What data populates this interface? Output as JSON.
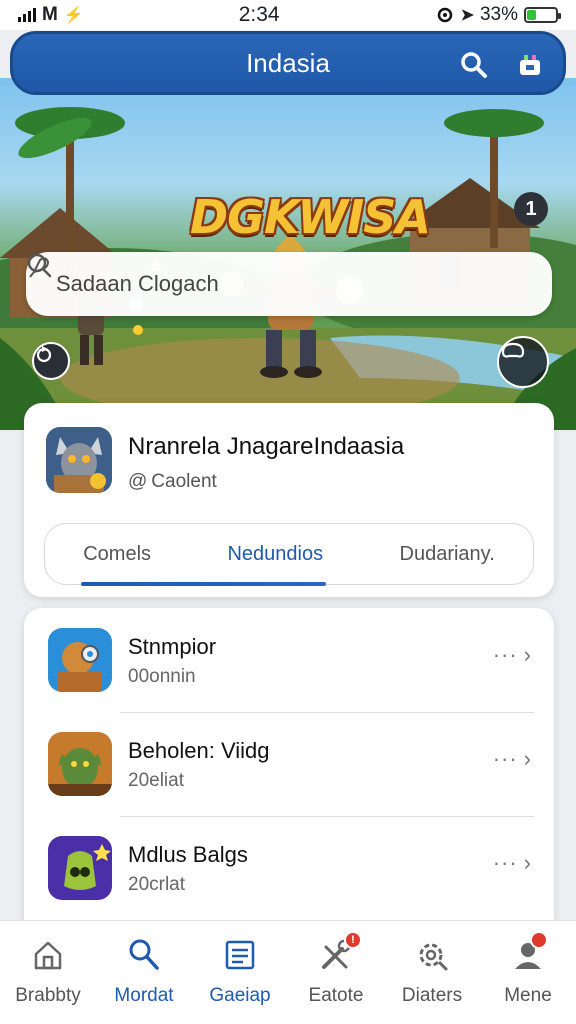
{
  "status_bar": {
    "carrier": "M",
    "network": "⚡",
    "time": "2:34",
    "battery_text": "33%",
    "battery_level": 0.33
  },
  "header": {
    "title": "Indasia",
    "search_icon": "search-icon",
    "store_icon": "store-icon"
  },
  "hero": {
    "logo_text": "DGKWISA",
    "notification_count": "1",
    "search_placeholder": "Sadaan Clogach"
  },
  "featured_app": {
    "name": "Nranrela JnagareΙndaasia",
    "subtitle": "Caolent",
    "tabs": [
      "Comels",
      "Nedundios",
      "Dudariany."
    ],
    "active_tab_index": 1
  },
  "app_list": [
    {
      "title": "Stnmpior",
      "subtitle": "00onnin",
      "more": "···"
    },
    {
      "title": "Beholen: Viidg",
      "subtitle": "20eliat",
      "more": "···"
    },
    {
      "title": "Mdlus Balgs",
      "subtitle": "20crlat",
      "more": "···"
    }
  ],
  "bottom_nav": [
    {
      "label": "Brabbty",
      "icon": "home-icon"
    },
    {
      "label": "Mordat",
      "icon": "search-icon",
      "active": true
    },
    {
      "label": "Gaeiap",
      "icon": "document-icon",
      "active": true
    },
    {
      "label": "Eatote",
      "icon": "tools-icon",
      "badge": "!"
    },
    {
      "label": "Diaters",
      "icon": "gear-icon"
    },
    {
      "label": "Mene",
      "icon": "profile-icon",
      "badge_dot": true
    }
  ],
  "colors": {
    "accent": "#1e5bb0",
    "header": "#2a66b8",
    "badge": "#e03a2e",
    "battery": "#33c13b"
  }
}
